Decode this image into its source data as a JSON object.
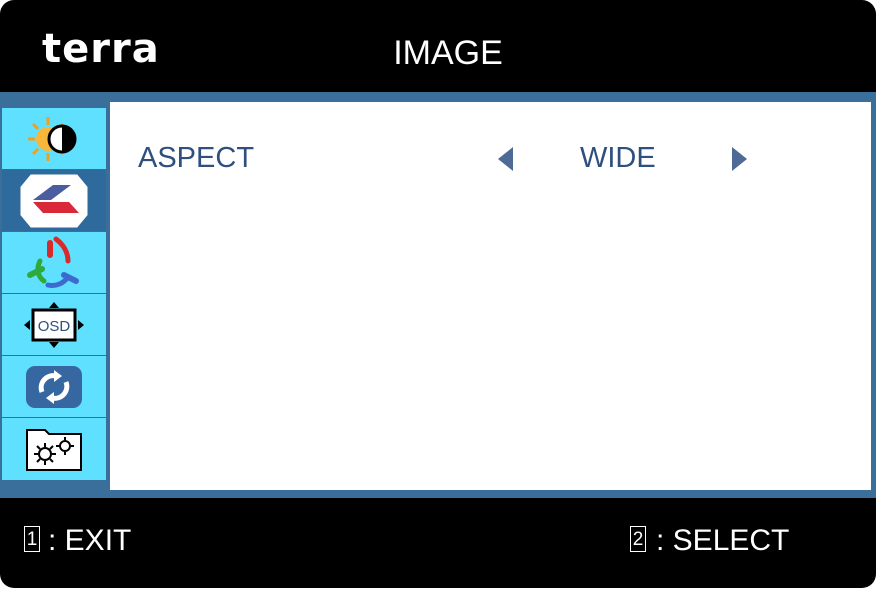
{
  "brand": {
    "logo": "terra"
  },
  "header": {
    "title": "IMAGE"
  },
  "sidebar": {
    "items": [
      {
        "name": "brightness",
        "icon": "brightness-contrast-icon"
      },
      {
        "name": "image",
        "icon": "image-aspect-icon",
        "active": true
      },
      {
        "name": "color",
        "icon": "rgb-color-icon"
      },
      {
        "name": "osd",
        "icon": "osd-settings-icon",
        "label": "OSD"
      },
      {
        "name": "reset",
        "icon": "reset-icon"
      },
      {
        "name": "misc",
        "icon": "misc-settings-icon"
      }
    ]
  },
  "setting": {
    "label": "ASPECT",
    "value": "WIDE"
  },
  "footer": {
    "exit_key": "1",
    "exit_label": ": EXIT",
    "select_key": "2",
    "select_label": ": SELECT"
  },
  "colors": {
    "background": "#000000",
    "frame": "#3a6f9c",
    "sidebar": "#5fe0ff",
    "sidebar_active": "#2f6a9d",
    "text": "#2f4f7f"
  }
}
